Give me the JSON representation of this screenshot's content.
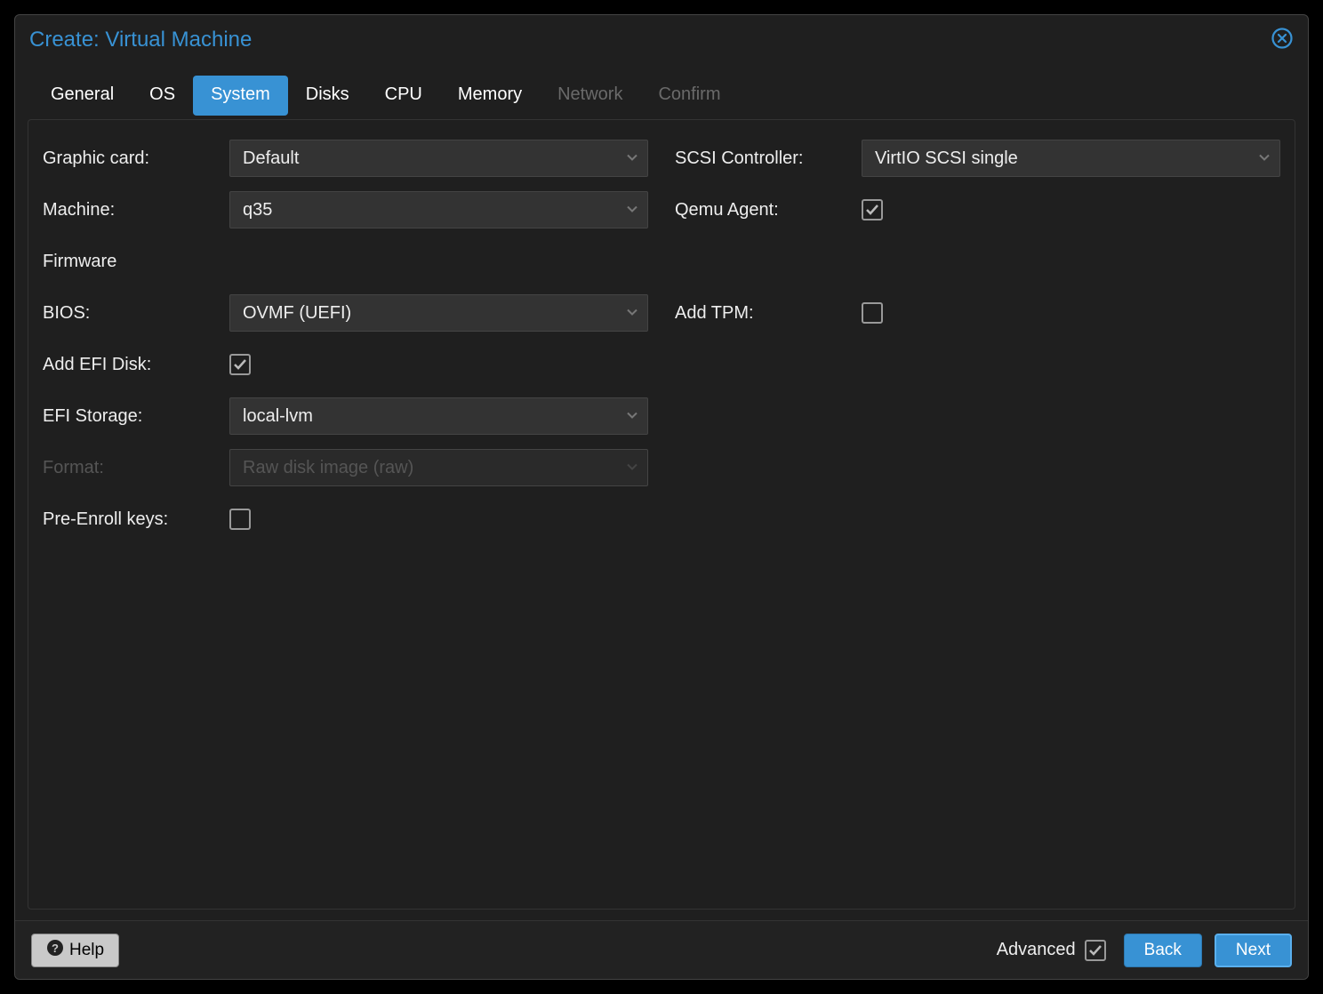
{
  "dialog": {
    "title": "Create: Virtual Machine"
  },
  "tabs": [
    {
      "label": "General",
      "state": "normal"
    },
    {
      "label": "OS",
      "state": "normal"
    },
    {
      "label": "System",
      "state": "active"
    },
    {
      "label": "Disks",
      "state": "normal"
    },
    {
      "label": "CPU",
      "state": "normal"
    },
    {
      "label": "Memory",
      "state": "normal"
    },
    {
      "label": "Network",
      "state": "disabled"
    },
    {
      "label": "Confirm",
      "state": "disabled"
    }
  ],
  "left": {
    "graphic_card": {
      "label": "Graphic card:",
      "value": "Default"
    },
    "machine": {
      "label": "Machine:",
      "value": "q35"
    },
    "firmware_header": "Firmware",
    "bios": {
      "label": "BIOS:",
      "value": "OVMF (UEFI)"
    },
    "add_efi_disk": {
      "label": "Add EFI Disk:",
      "checked": true
    },
    "efi_storage": {
      "label": "EFI Storage:",
      "value": "local-lvm"
    },
    "format": {
      "label": "Format:",
      "value": "Raw disk image (raw)",
      "disabled": true
    },
    "pre_enroll": {
      "label": "Pre-Enroll keys:",
      "checked": false
    }
  },
  "right": {
    "scsi": {
      "label": "SCSI Controller:",
      "value": "VirtIO SCSI single"
    },
    "qemu_agent": {
      "label": "Qemu Agent:",
      "checked": true
    },
    "add_tpm": {
      "label": "Add TPM:",
      "checked": false
    }
  },
  "footer": {
    "help": "Help",
    "advanced": {
      "label": "Advanced",
      "checked": true
    },
    "back": "Back",
    "next": "Next"
  }
}
